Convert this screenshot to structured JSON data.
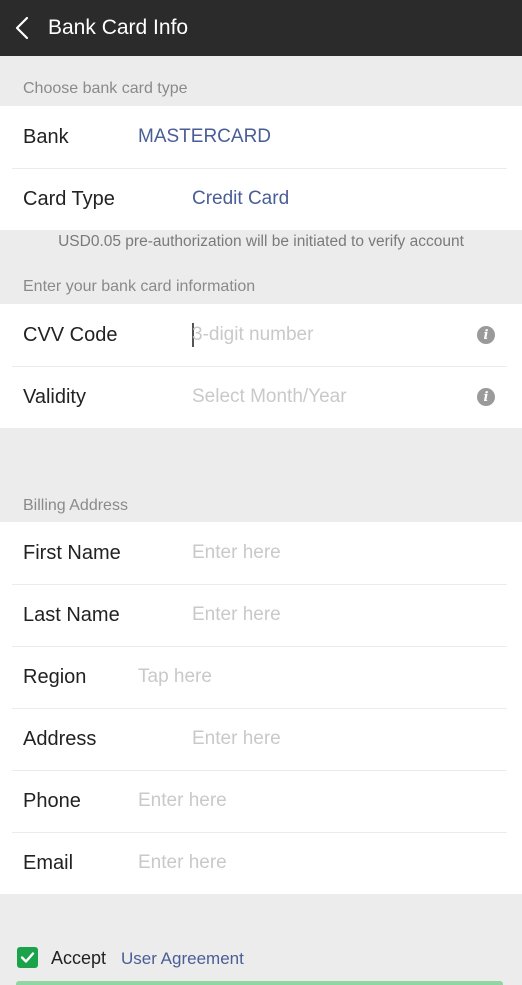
{
  "header": {
    "title": "Bank Card Info"
  },
  "card_type_section": {
    "label": "Choose bank card type",
    "bank": {
      "label": "Bank",
      "value": "MASTERCARD"
    },
    "card_type": {
      "label": "Card Type",
      "value": "Credit Card"
    }
  },
  "notice": "USD0.05 pre-authorization will be initiated to verify account",
  "card_info_section": {
    "label": "Enter your bank card information",
    "cvv": {
      "label": "CVV Code",
      "placeholder": "3-digit number"
    },
    "validity": {
      "label": "Validity",
      "placeholder": "Select Month/Year"
    }
  },
  "billing_section": {
    "label": "Billing Address",
    "first_name": {
      "label": "First Name",
      "placeholder": "Enter here"
    },
    "last_name": {
      "label": "Last Name",
      "placeholder": "Enter here"
    },
    "region": {
      "label": "Region",
      "placeholder": "Tap here"
    },
    "address": {
      "label": "Address",
      "placeholder": "Enter here"
    },
    "phone": {
      "label": "Phone",
      "placeholder": "Enter here"
    },
    "email": {
      "label": "Email",
      "placeholder": "Enter here"
    }
  },
  "agreement": {
    "checked": true,
    "accept_label": "Accept",
    "link_label": "User Agreement"
  },
  "colors": {
    "header_bg": "#2b2b2b",
    "link_blue": "#4a5e96",
    "accent_green": "#1aa34a"
  },
  "icons": {
    "back": "chevron-left-icon",
    "info": "info-icon",
    "check": "check-icon"
  }
}
